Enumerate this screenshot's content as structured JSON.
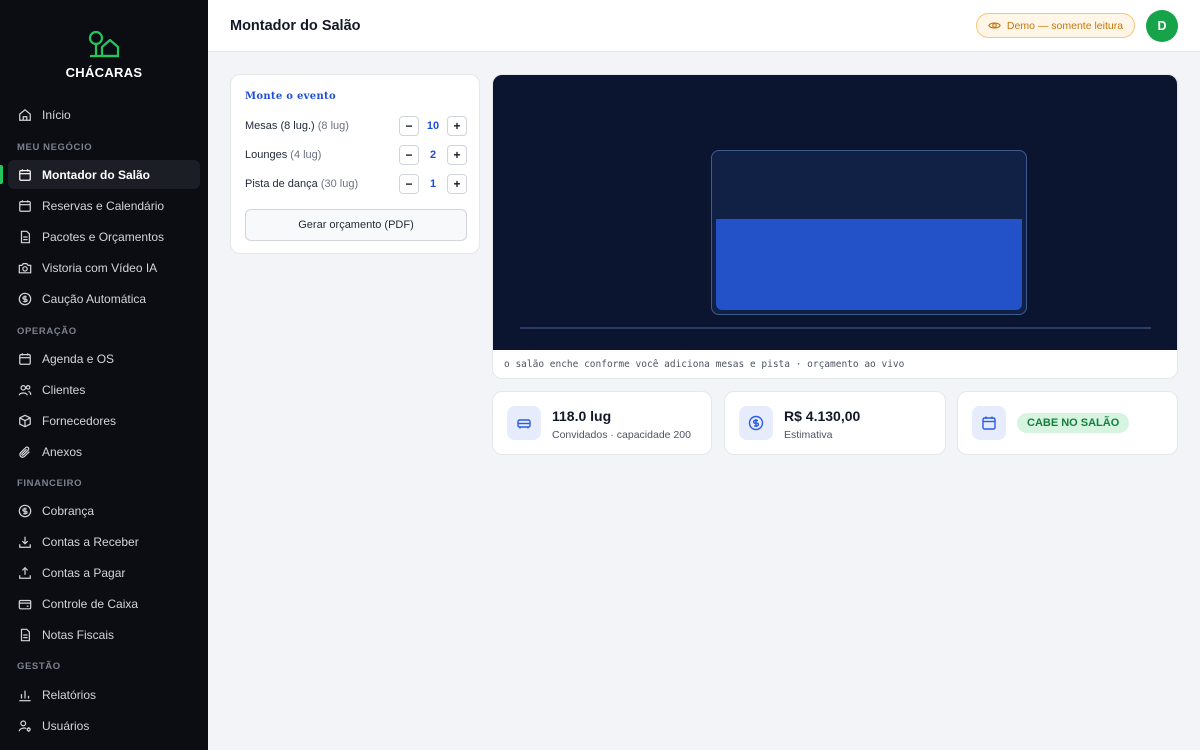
{
  "brand": {
    "name": "CHÁCARAS",
    "color": "#22c55e"
  },
  "sidebar": {
    "home": "Início",
    "sections": {
      "business": "MEU NEGÓCIO",
      "operation": "OPERAÇÃO",
      "finance": "FINANCEIRO",
      "management": "GESTÃO"
    },
    "business_items": [
      "Montador do Salão",
      "Reservas e Calendário",
      "Pacotes e Orçamentos",
      "Vistoria com Vídeo IA",
      "Caução Automática"
    ],
    "operation_items": [
      "Agenda e OS",
      "Clientes",
      "Fornecedores",
      "Anexos"
    ],
    "finance_items": [
      "Cobrança",
      "Contas a Receber",
      "Contas a Pagar",
      "Controle de Caixa",
      "Notas Fiscais"
    ],
    "management_items": [
      "Relatórios",
      "Usuários"
    ]
  },
  "header": {
    "title": "Montador do Salão",
    "demo_badge": "Demo — somente leitura",
    "avatar_initial": "D"
  },
  "event": {
    "title": "Monte o evento",
    "rows": [
      {
        "label": "Mesas (8 lug.)",
        "sub": "(8 lug)",
        "value": "10"
      },
      {
        "label": "Lounges",
        "sub": "(4 lug)",
        "value": "2"
      },
      {
        "label": "Pista de dança",
        "sub": "(30 lug)",
        "value": "1"
      }
    ],
    "minus": "−",
    "plus": "+",
    "pdf_button": "Gerar orçamento (PDF)"
  },
  "hall": {
    "caption": "o salão enche conforme você adiciona mesas e pista · orçamento ao vivo",
    "fill_fraction": 0.59
  },
  "stats": {
    "guests_value": "118.0 lug",
    "guests_caption": "Convidados · capacidade 200",
    "estimate_value": "R$ 4.130,00",
    "estimate_caption": "Estimativa",
    "fit_status": "CABE NO SALÃO"
  }
}
